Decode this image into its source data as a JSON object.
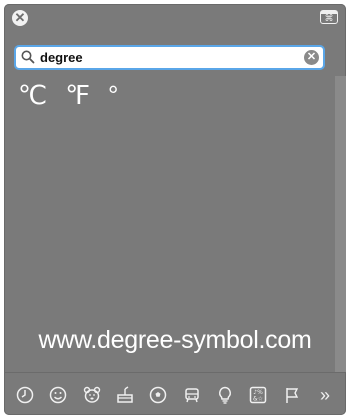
{
  "window": {
    "close_glyph": "✕",
    "viewer_glyph": "⌘"
  },
  "search": {
    "value": "degree",
    "placeholder": "Search",
    "clear_glyph": "✕"
  },
  "results": [
    {
      "symbol": "℃"
    },
    {
      "symbol": "℉"
    },
    {
      "symbol": "°"
    }
  ],
  "watermark": "www.degree-symbol.com",
  "toolbar": {
    "icons": [
      "recent-icon",
      "smiley-icon",
      "animal-icon",
      "food-icon",
      "ball-icon",
      "travel-icon",
      "lightbulb-icon",
      "symbols-icon",
      "flag-icon"
    ],
    "more_glyph": "»"
  }
}
